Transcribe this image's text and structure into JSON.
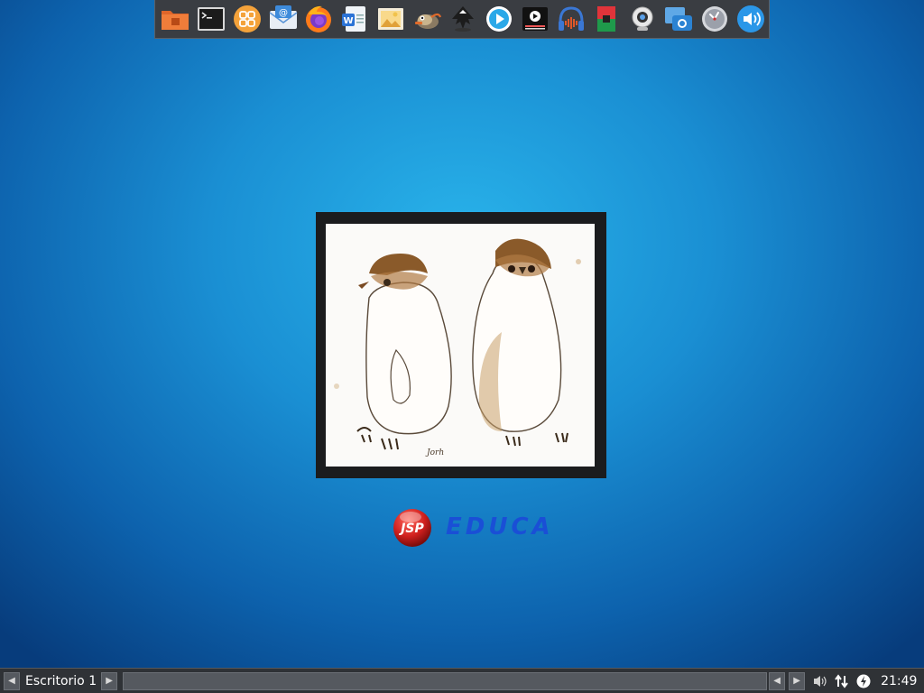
{
  "dock": {
    "items": [
      {
        "name": "file-manager"
      },
      {
        "name": "terminal"
      },
      {
        "name": "app-menu"
      },
      {
        "name": "mail-client"
      },
      {
        "name": "firefox"
      },
      {
        "name": "word-processor"
      },
      {
        "name": "image-viewer"
      },
      {
        "name": "gimp"
      },
      {
        "name": "inkscape"
      },
      {
        "name": "media-player"
      },
      {
        "name": "video-editor"
      },
      {
        "name": "audio-editor"
      },
      {
        "name": "colors-tool"
      },
      {
        "name": "webcam"
      },
      {
        "name": "screenshot-tool"
      },
      {
        "name": "clock"
      },
      {
        "name": "volume"
      }
    ]
  },
  "wallpaper": {
    "drawing_signature": "Jorh",
    "logo_badge": "JSP",
    "logo_text": "EDUCA"
  },
  "panel": {
    "workspace_label": "Escritorio 1",
    "prev_arrow": "◀",
    "next_arrow": "▶",
    "clock": "21:49"
  },
  "colors": {
    "logo_text": "#1a4fd6",
    "panel_bg": "#2f3236",
    "dock_bg": "#3a3d42"
  }
}
